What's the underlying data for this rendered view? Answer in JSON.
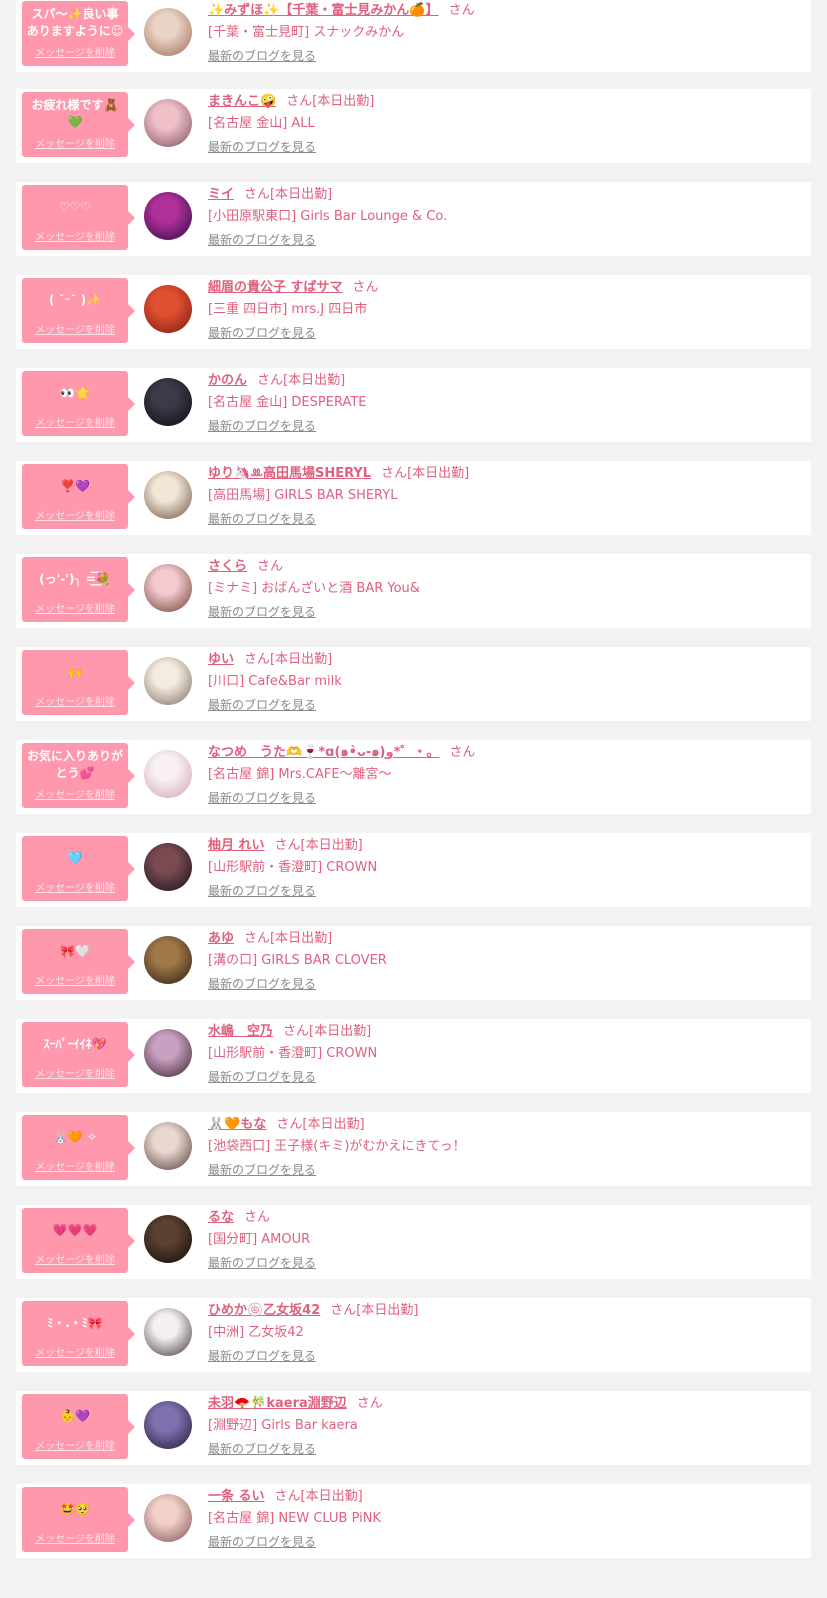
{
  "labels": {
    "delete": "メッセージを削除",
    "blog": "最新のブログを見る",
    "san": "さん"
  },
  "colors": {
    "bubble": "#ff98ad",
    "accent": "#e0607d",
    "link_gray": "#8a8a8a"
  },
  "entries": [
    {
      "message": "スパ〜✨良い事ありますように☺",
      "name": "✨みずほ✨【千葉・富士見みかん🍊】",
      "badge": "",
      "shop": "[千葉・富士見町] スナックみかん",
      "avatar": [
        "#e8d3c7",
        "#9b6a4f"
      ]
    },
    {
      "message": "お疲れ様です🧸💚",
      "name": "まきんこ🤪",
      "badge": "[本日出勤]",
      "shop": "[名古屋 金山] ALL",
      "avatar": [
        "#f0c0c8",
        "#7a4a5a"
      ]
    },
    {
      "message": "♡♡♡",
      "name": "ミイ",
      "badge": "[本日出勤]",
      "shop": "[小田原駅東口] Girls Bar Lounge & Co.",
      "avatar": [
        "#b0309a",
        "#2a0a40"
      ]
    },
    {
      "message": "( ˘ᵕ˘ )✨",
      "name": "細眉の貴公子 すばサマ",
      "badge": "",
      "shop": "[三重 四日市] mrs.J 四日市",
      "avatar": [
        "#e05030",
        "#7a1a10"
      ]
    },
    {
      "message": "👀🌟",
      "name": "かのん",
      "badge": "[本日出勤]",
      "shop": "[名古屋 金山] DESPERATE",
      "avatar": [
        "#3a3a48",
        "#0a0a12"
      ]
    },
    {
      "message": "❣️💜",
      "name": "ゆり🦄ꔛ高田馬場SHERYL",
      "badge": "[本日出勤]",
      "shop": "[高田馬場] GIRLS BAR SHERYL",
      "avatar": [
        "#f2e6d6",
        "#6a5040"
      ]
    },
    {
      "message": "(っ'-')╮ =͟͟͞͞💐",
      "name": "さくら",
      "badge": "",
      "shop": "[ミナミ] おばんざいと酒 BAR You&",
      "avatar": [
        "#f4cad0",
        "#6a3a2a"
      ]
    },
    {
      "message": "🙌",
      "name": "ゆい",
      "badge": "[本日出勤]",
      "shop": "[川口] Cafe&Bar milk",
      "avatar": [
        "#f4ece0",
        "#7a6a60"
      ]
    },
    {
      "message": "お気に入りありがとう💕",
      "name": "なつめ　うた🫶🍷*ɑ(๑•̀ᴗ-๑)و*゜・。",
      "badge": "",
      "shop": "[名古屋 錦] Mrs.CAFE〜離宮〜",
      "avatar": [
        "#f8f0f4",
        "#d0a0b0"
      ]
    },
    {
      "message": "🩵",
      "name": "柚月 れい",
      "badge": "[本日出勤]",
      "shop": "[山形駅前・香澄町] CROWN",
      "avatar": [
        "#7a4a50",
        "#141018"
      ]
    },
    {
      "message": "🎀🤍",
      "name": "あゆ",
      "badge": "[本日出勤]",
      "shop": "[溝の口] GIRLS BAR CLOVER",
      "avatar": [
        "#a07848",
        "#2a1a10"
      ]
    },
    {
      "message": "ｽｰﾊﾟｰｲｲﾈ💖",
      "name": "水嶋　空乃",
      "badge": "[本日出勤]",
      "shop": "[山形駅前・香澄町] CROWN",
      "avatar": [
        "#c8a0c0",
        "#3a2030"
      ]
    },
    {
      "message": "🐰🧡 ✧",
      "name": "🐰🧡もな",
      "badge": "[本日出勤]",
      "shop": "[池袋西口] 王子様(キミ)がむかえにきてっ！",
      "avatar": [
        "#e8d8d0",
        "#503838"
      ]
    },
    {
      "message": "💗💗💗",
      "name": "るな",
      "badge": "",
      "shop": "[国分町] AMOUR",
      "avatar": [
        "#5a4030",
        "#100808"
      ]
    },
    {
      "message": "ﾐ・.・ﾐ🎀",
      "name": "ひめか🍥乙女坂42",
      "badge": "[本日出勤]",
      "shop": "[中洲] 乙女坂42",
      "avatar": [
        "#f4f0f2",
        "#403038"
      ]
    },
    {
      "message": "👶💜",
      "name": "未羽🪭🎋kaera淵野辺",
      "badge": "",
      "shop": "[淵野辺] Girls Bar kaera",
      "avatar": [
        "#8070b0",
        "#201830"
      ]
    },
    {
      "message": "🤩🥺",
      "name": "一条 るい",
      "badge": "[本日出勤]",
      "shop": "[名古屋 錦] NEW CLUB PiNK",
      "avatar": [
        "#f0d0c8",
        "#805050"
      ]
    }
  ]
}
